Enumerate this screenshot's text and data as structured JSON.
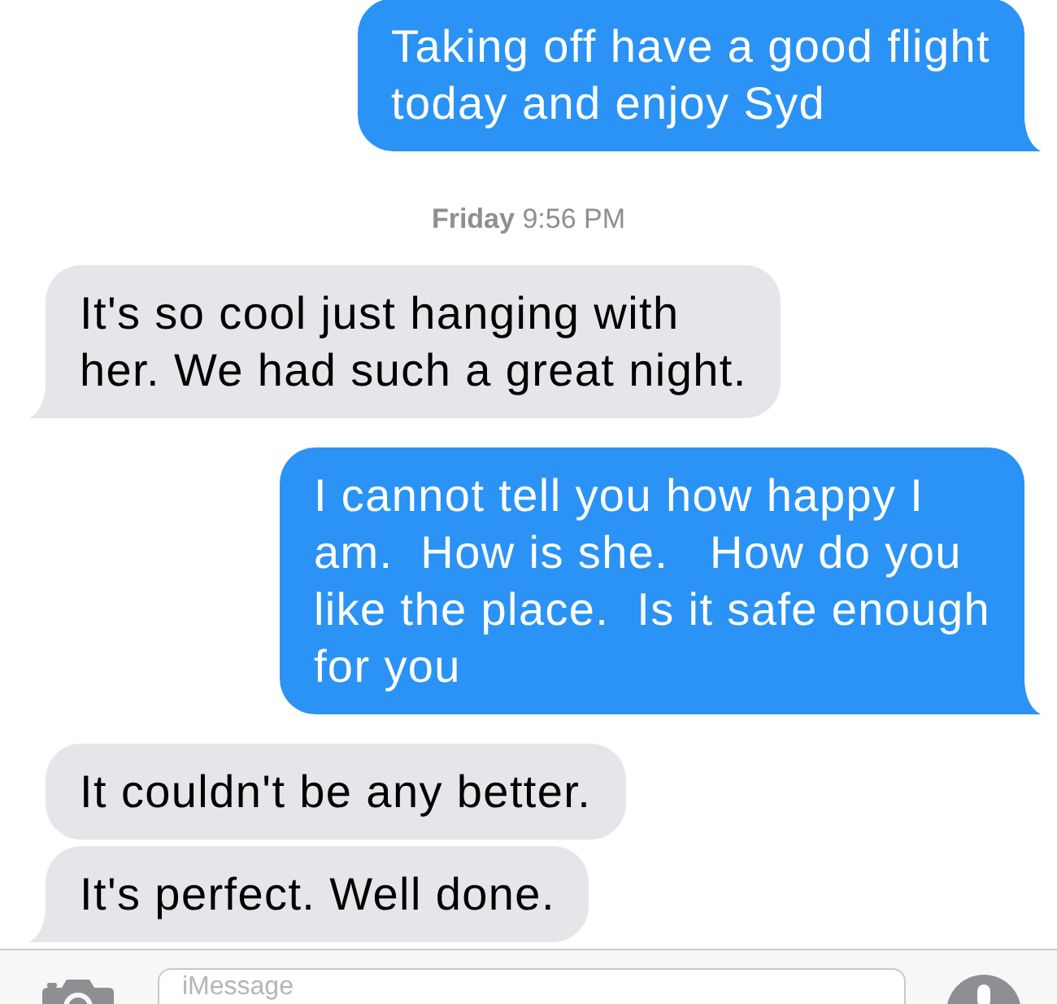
{
  "conversation": [
    {
      "kind": "sent",
      "text": "Taking off have a good flight\ntoday and enjoy Syd",
      "tail": true
    },
    {
      "kind": "timestamp",
      "text": "**Friday** 9:56 PM"
    },
    {
      "kind": "received",
      "text": "It's so cool just hanging with\nher. We had such a great night.",
      "tail": true
    },
    {
      "kind": "sent",
      "text": "I cannot tell you how happy I\nam.  How is she.   How do you\nlike the place.  Is it safe enough\nfor you",
      "tail": true
    },
    {
      "kind": "received",
      "text": "It couldn't be any better.",
      "tail": false
    },
    {
      "kind": "received",
      "text": "It's perfect. Well done.",
      "tail": true
    }
  ],
  "composer": {
    "placeholder": "iMessage"
  }
}
